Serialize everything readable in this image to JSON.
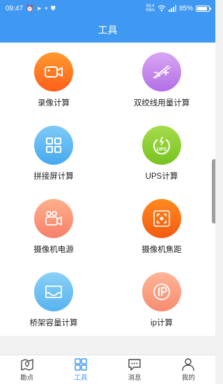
{
  "status": {
    "time": "09:47",
    "net_speed_top": "93.4",
    "net_speed_bottom": "KB/s",
    "battery": "85%",
    "battery_level": 0.85
  },
  "header": {
    "title": "工具"
  },
  "tools": [
    {
      "label": "录像计算",
      "icon": "video-camera-icon",
      "color_from": "#ff9a2e",
      "color_to": "#ff5e1a"
    },
    {
      "label": "双绞线用量计算",
      "icon": "twisted-cable-icon",
      "color_from": "#d9a6f2",
      "color_to": "#b26fe6"
    },
    {
      "label": "拼接屏计算",
      "icon": "grid-icon",
      "color_from": "#7fcaf7",
      "color_to": "#47a9ef"
    },
    {
      "label": "UPS计算",
      "icon": "ups-icon",
      "color_from": "#a6dc4c",
      "color_to": "#78c21f"
    },
    {
      "label": "摄像机电源",
      "icon": "camera-power-icon",
      "color_from": "#ffb08c",
      "color_to": "#f7806a"
    },
    {
      "label": "摄像机焦距",
      "icon": "focus-icon",
      "color_from": "#ff8a1f",
      "color_to": "#f45a10"
    },
    {
      "label": "桥架容量计算",
      "icon": "tray-icon",
      "color_from": "#8ad0f7",
      "color_to": "#58b3ef"
    },
    {
      "label": "ip计算",
      "icon": "ip-icon",
      "color_from": "#ffb496",
      "color_to": "#f78c70"
    }
  ],
  "nav": [
    {
      "label": "勘点",
      "icon": "map-pin-icon"
    },
    {
      "label": "工具",
      "icon": "tools-grid-icon",
      "active": true
    },
    {
      "label": "消息",
      "icon": "message-icon"
    },
    {
      "label": "我的",
      "icon": "user-icon"
    }
  ]
}
